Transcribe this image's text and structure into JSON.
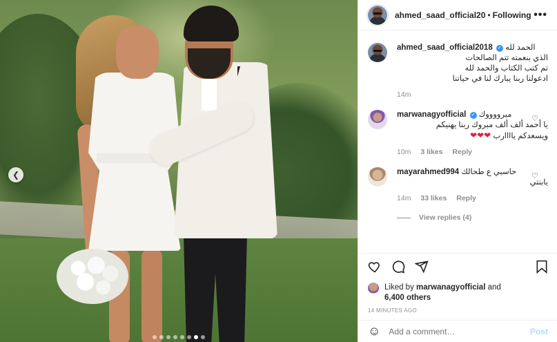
{
  "colors": {
    "accent": "#3897f0",
    "muted": "#8e8e8e",
    "text": "#262626",
    "heart": "#e02041"
  },
  "media": {
    "dots_total": 8,
    "dot_active": 7,
    "prev_icon": "chevron-left-icon"
  },
  "header": {
    "username": "ahmed_saad_official20",
    "separator": "•",
    "follow_status": "Following",
    "more_icon": "more-icon"
  },
  "caption": {
    "username": "ahmed_saad_official2018",
    "lines": [
      "الحمد لله",
      "الذي بنعمته تتم الصالحات",
      "تم كتب الكتاب والحمد لله",
      "ادعولنا ربنا يبارك لنا في حياتنا"
    ],
    "time": "14m"
  },
  "comments": [
    {
      "username": "marwanagyofficial",
      "verified": true,
      "lines": [
        "مبرووووك",
        "يا أحمد ألف ألف مبروك ربنا يهنيكم",
        "ويسعدكم ياااارب"
      ],
      "hearts": "❤❤❤",
      "time": "10m",
      "likes": "3 likes",
      "reply": "Reply"
    },
    {
      "username": "mayarahmed994",
      "verified": false,
      "lines": [
        "حاسبي ع طحالك",
        "يابنتي"
      ],
      "time": "14m",
      "likes": "33 likes",
      "reply": "Reply"
    }
  ],
  "view_replies": "View replies (4)",
  "likes": {
    "prefix": "Liked by",
    "user": "marwanagyofficial",
    "and": "and",
    "others": "6,400 others"
  },
  "timestamp": "14 MINUTES AGO",
  "add_comment": {
    "placeholder": "Add a comment…",
    "post": "Post"
  }
}
